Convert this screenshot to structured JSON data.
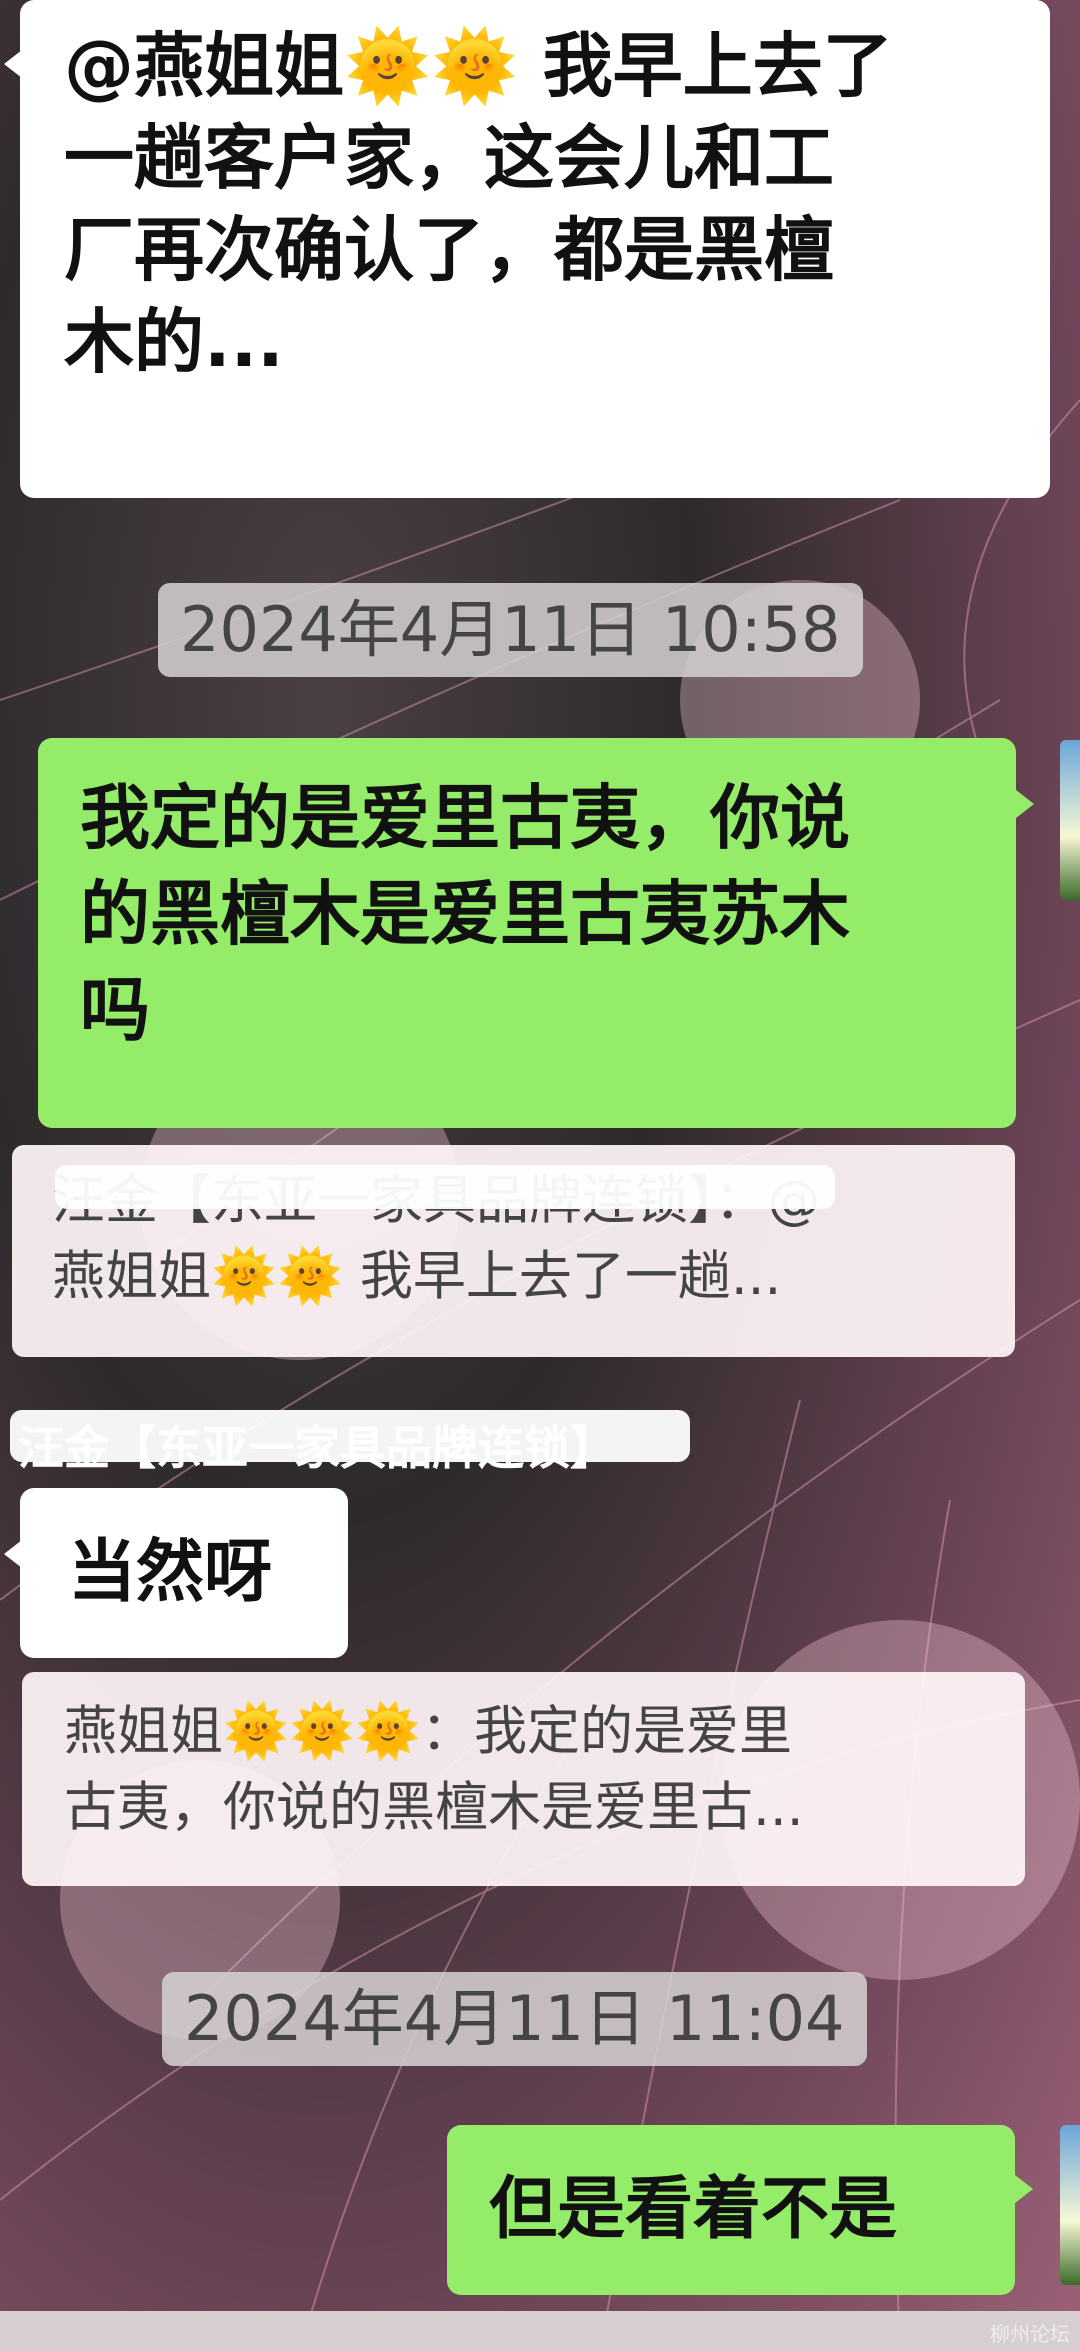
{
  "messages": {
    "top_left_bubble": {
      "lines": [
        "@燕姐姐🌞🌞 我早上去了",
        "一趟客户家，这会儿和工",
        "厂再次确认了，都是黑檀",
        "木的..."
      ]
    },
    "timestamp_1": "2024年4月11日 10:58",
    "right_bubble_1": {
      "lines": [
        "我定的是爱里古夷，你说",
        "的黑檀木是爱里古夷苏木",
        "吗"
      ]
    },
    "quote_1": {
      "lines": [
        "汪金【东亚一家具品牌连锁】：@",
        "燕姐姐🌞🌞 我早上去了一趟..."
      ]
    },
    "sender_name": "汪金【东亚一家具品牌连锁】",
    "left_bubble_2": "当然呀",
    "quote_2": {
      "lines": [
        "燕姐姐🌞🌞🌞：我定的是爱里",
        "古夷，你说的黑檀木是爱里古..."
      ]
    },
    "timestamp_2": "2024年4月11日 11:04",
    "right_bubble_2": "但是看着不是"
  },
  "watermark": "柳州论坛"
}
